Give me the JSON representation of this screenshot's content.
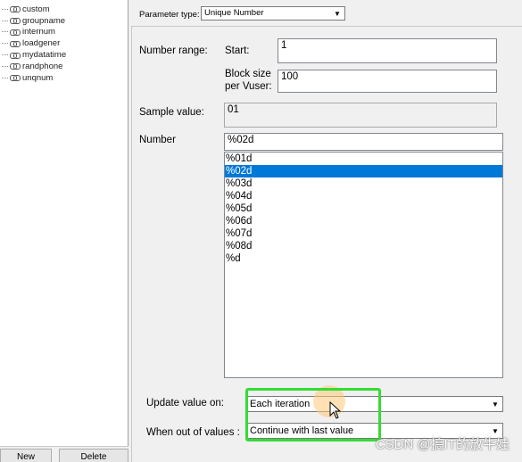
{
  "tree": {
    "items": [
      "custom",
      "groupname",
      "internum",
      "loadgener",
      "mydatatime",
      "randphone",
      "unqnum"
    ]
  },
  "left_buttons": {
    "new_label": "New",
    "delete_label": "Delete"
  },
  "parameter_type": {
    "label": "Parameter type:",
    "value": "Unique Number"
  },
  "number_range": {
    "label": "Number range:",
    "start_label": "Start:",
    "start_value": "1",
    "block_size_label_1": "Block size",
    "block_size_label_2": "per Vuser:",
    "block_size_value": "100"
  },
  "sample": {
    "label": "Sample value:",
    "value": "01"
  },
  "number_format": {
    "label": "Number",
    "value": "%02d",
    "options": [
      "%01d",
      "%02d",
      "%03d",
      "%04d",
      "%05d",
      "%06d",
      "%07d",
      "%08d",
      "%d"
    ],
    "selected": "%02d"
  },
  "update_value": {
    "label": "Update value on:",
    "value": "Each iteration"
  },
  "out_of_values": {
    "label": "When out of values :",
    "value": "Continue with last value"
  },
  "watermark": "CSDN @搞IT的放牛娃",
  "colors": {
    "selection": "#0078d7",
    "highlight": "#33dd33"
  }
}
